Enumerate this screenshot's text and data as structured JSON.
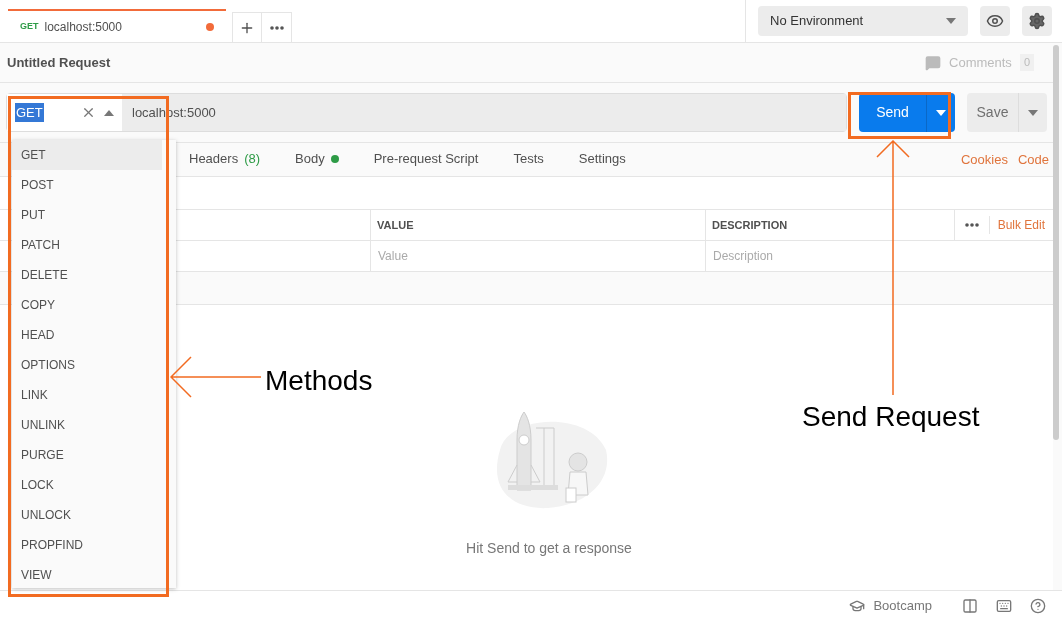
{
  "open_tabs": [
    {
      "method": "GET",
      "label": "localhost:5000",
      "selected": true,
      "unsaved": true
    }
  ],
  "environment": {
    "value": "No Environment"
  },
  "request": {
    "title": "Untitled Request",
    "comments_label": "Comments",
    "comments_count": "0",
    "method": "GET",
    "url": "localhost:5000",
    "send_label": "Send",
    "save_label": "Save"
  },
  "request_tabs": [
    {
      "label": "Headers",
      "count": "(8)",
      "has_content": false,
      "selected": false
    },
    {
      "label": "Body",
      "has_content": true,
      "selected": false
    },
    {
      "label": "Pre-request Script",
      "has_content": false,
      "selected": false
    },
    {
      "label": "Tests",
      "has_content": false,
      "selected": false
    },
    {
      "label": "Settings",
      "has_content": false,
      "selected": false
    }
  ],
  "request_links": [
    "Cookies",
    "Code"
  ],
  "params_table": {
    "columns": [
      "VALUE",
      "DESCRIPTION"
    ],
    "bulk_edit": "Bulk Edit",
    "placeholders": [
      "Value",
      "Description"
    ]
  },
  "response": {
    "empty_message": "Hit Send to get a response"
  },
  "status_bar": {
    "bootcamp": "Bootcamp"
  },
  "methods_menu": [
    {
      "label": "GET",
      "selected": true
    },
    {
      "label": "POST",
      "selected": false
    },
    {
      "label": "PUT",
      "selected": false
    },
    {
      "label": "PATCH",
      "selected": false
    },
    {
      "label": "DELETE",
      "selected": false
    },
    {
      "label": "COPY",
      "selected": false
    },
    {
      "label": "HEAD",
      "selected": false
    },
    {
      "label": "OPTIONS",
      "selected": false
    },
    {
      "label": "LINK",
      "selected": false
    },
    {
      "label": "UNLINK",
      "selected": false
    },
    {
      "label": "PURGE",
      "selected": false
    },
    {
      "label": "LOCK",
      "selected": false
    },
    {
      "label": "UNLOCK",
      "selected": false
    },
    {
      "label": "PROPFIND",
      "selected": false
    },
    {
      "label": "VIEW",
      "selected": false
    }
  ],
  "annotations": {
    "methods": "Methods",
    "send": "Send Request"
  }
}
